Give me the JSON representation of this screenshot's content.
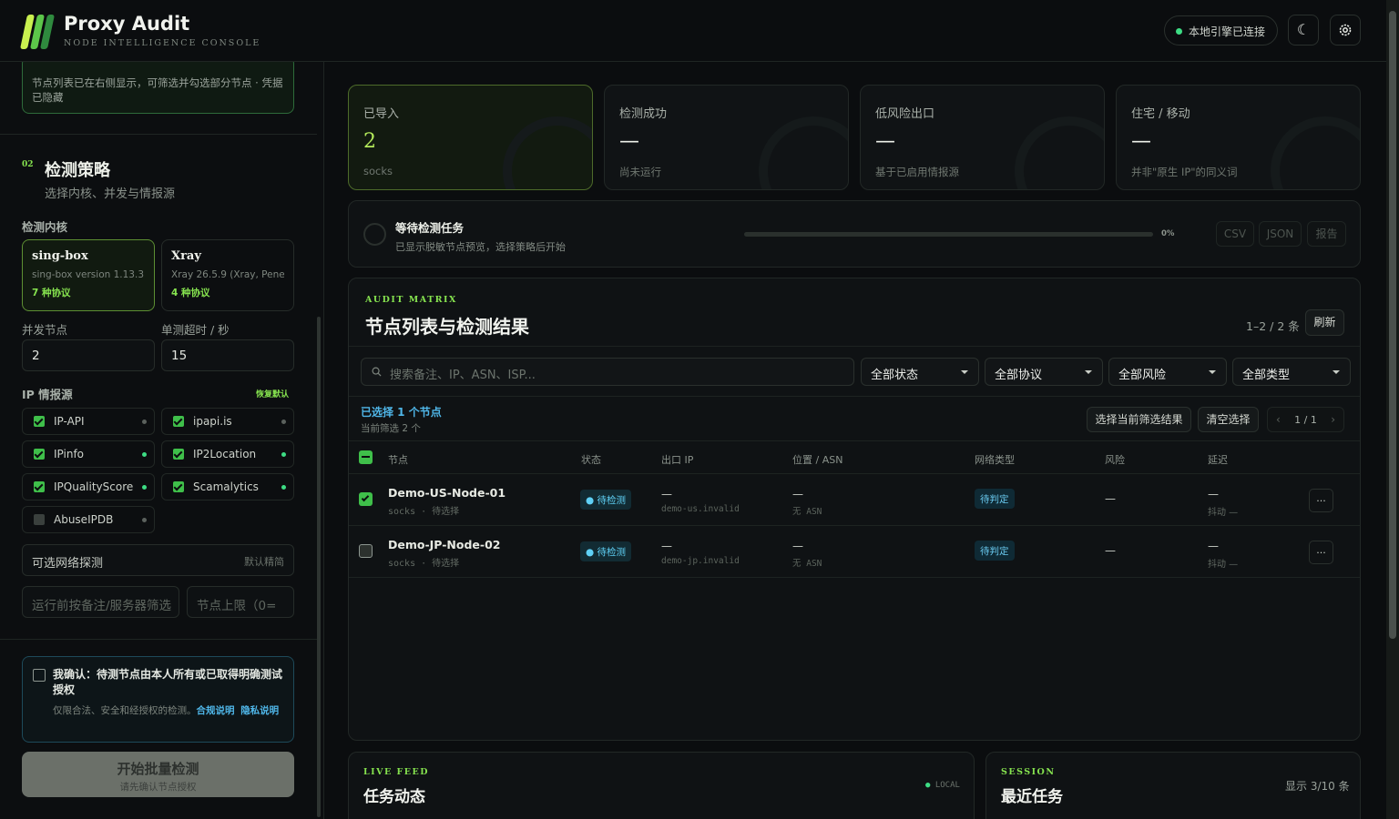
{
  "app": {
    "title": "Proxy Audit",
    "subtitle": "NODE INTELLIGENCE CONSOLE",
    "engine_status": "本地引擎已连接"
  },
  "sidebar": {
    "import_note": "节点列表已在右侧显示，可筛选并勾选部分节点 · 凭据已隐藏",
    "section_num": "02",
    "section_title": "检测策略",
    "section_sub": "选择内核、并发与情报源",
    "core_label": "检测内核",
    "cores": [
      {
        "name": "sing-box",
        "version": "sing-box version 1.13.3",
        "protocols": "7 种协议"
      },
      {
        "name": "Xray",
        "version": "Xray 26.5.9 (Xray, Penet...",
        "protocols": "4 种协议"
      }
    ],
    "concurrency_label": "并发节点",
    "concurrency_value": "2",
    "timeout_label": "单测超时 / 秒",
    "timeout_value": "15",
    "intel_label": "IP 情报源",
    "intel_reset": "恢复默认",
    "intel_sources": [
      {
        "name": "IP-API",
        "checked": true
      },
      {
        "name": "ipapi.is",
        "checked": true
      },
      {
        "name": "IPinfo",
        "checked": true
      },
      {
        "name": "IP2Location",
        "checked": true
      },
      {
        "name": "IPQualityScore",
        "checked": true
      },
      {
        "name": "Scamalytics",
        "checked": true
      },
      {
        "name": "AbuseIPDB",
        "checked": false
      }
    ],
    "network_probe_label": "可选网络探测",
    "network_probe_value": "默认精简",
    "filter_placeholder": "运行前按备注/服务器筛选",
    "limit_placeholder": "节点上限（0=",
    "consent_title": "我确认：待测节点由本人所有或已取得明确测试授权",
    "consent_desc": "仅限合法、安全和经授权的检测。",
    "consent_link1": "合规说明",
    "consent_link2": "隐私说明",
    "start_label": "开始批量检测",
    "start_hint": "请先确认节点授权"
  },
  "stats": [
    {
      "title": "已导入",
      "value": "2",
      "sub": "socks"
    },
    {
      "title": "检测成功",
      "value": "—",
      "sub": "尚未运行"
    },
    {
      "title": "低风险出口",
      "value": "—",
      "sub": "基于已启用情报源"
    },
    {
      "title": "住宅 / 移动",
      "value": "—",
      "sub": "并非\"原生 IP\"的同义词"
    }
  ],
  "task": {
    "title": "等待检测任务",
    "sub": "已显示脱敏节点预览，选择策略后开始",
    "progress": 0,
    "progress_label": "0%",
    "export": [
      "CSV",
      "JSON",
      "报告"
    ]
  },
  "matrix": {
    "eyebrow": "AUDIT MATRIX",
    "title": "节点列表与检测结果",
    "count": "1–2 / 2 条",
    "refresh": "刷新",
    "search_placeholder": "搜索备注、IP、ASN、ISP...",
    "filters": [
      "全部状态",
      "全部协议",
      "全部风险",
      "全部类型"
    ],
    "selected": "已选择 1 个节点",
    "filtered": "当前筛选 2 个",
    "select_filtered": "选择当前筛选结果",
    "clear_selection": "清空选择",
    "page": "1 / 1",
    "columns": [
      "节点",
      "状态",
      "出口 IP",
      "位置 / ASN",
      "网络类型",
      "风险",
      "延迟"
    ],
    "rows": [
      {
        "name": "Demo-US-Node-01",
        "sub": "socks · 待选择",
        "status": "待检测",
        "ip": "—",
        "host": "demo-us.invalid",
        "loc": "—",
        "asn": "无 ASN",
        "type": "待判定",
        "risk": "—",
        "latency": "—",
        "jitter": "抖动 —",
        "checked": true
      },
      {
        "name": "Demo-JP-Node-02",
        "sub": "socks · 待选择",
        "status": "待检测",
        "ip": "—",
        "host": "demo-jp.invalid",
        "loc": "—",
        "asn": "无 ASN",
        "type": "待判定",
        "risk": "—",
        "latency": "—",
        "jitter": "抖动 —",
        "checked": false
      }
    ]
  },
  "feed": {
    "eyebrow": "LIVE FEED",
    "title": "任务动态",
    "badge": "LOCAL"
  },
  "session": {
    "eyebrow": "SESSION",
    "title": "最近任务",
    "count": "显示 3/10 条"
  },
  "colors": {
    "accent": "#86e34f",
    "brand_green": "#3fbf4a",
    "info_blue": "#4fb6e8"
  }
}
